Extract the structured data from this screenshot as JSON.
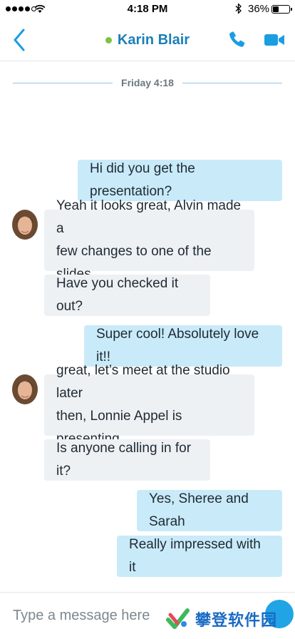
{
  "status_bar": {
    "signal_dots_filled": 4,
    "signal_dots_total": 5,
    "time": "4:18 PM",
    "battery_percent": "36%",
    "battery_level": 0.36,
    "icons": [
      "wifi-icon",
      "bluetooth-icon",
      "battery-icon"
    ]
  },
  "header": {
    "contact_name": "Karin Blair",
    "presence": "online",
    "presence_color": "#7cc243",
    "accent_color": "#1b7fb8",
    "icons": [
      "back-chevron-icon",
      "phone-icon",
      "video-camera-icon"
    ]
  },
  "conversation": {
    "date_label": "Friday 4:18",
    "messages": [
      {
        "direction": "outgoing",
        "text": "Hi did you get the presentation?"
      },
      {
        "direction": "incoming",
        "text": "Yeah it looks great, Alvin made a few changes to one of the slides",
        "line1": "Yeah it looks great, Alvin made a",
        "line2": "few changes to one of the slides",
        "avatar": true
      },
      {
        "direction": "incoming",
        "text": "Have you checked it out?"
      },
      {
        "direction": "outgoing",
        "text": "Super cool! Absolutely love it!!"
      },
      {
        "direction": "incoming",
        "text": "great, let's meet at the studio later then, Lonnie Appel is presenting",
        "line1": "great, let’s meet at the studio later",
        "line2": "then, Lonnie Appel is presenting",
        "avatar": true
      },
      {
        "direction": "incoming",
        "text": "Is anyone calling in for it?"
      },
      {
        "direction": "outgoing",
        "text": "Yes, Sheree and Sarah"
      },
      {
        "direction": "outgoing",
        "text": "Really impressed with it"
      }
    ],
    "outgoing_bubble_color": "#c9eaf9",
    "incoming_bubble_color": "#eef1f4"
  },
  "composer": {
    "placeholder": "Type a message here",
    "value": ""
  },
  "watermark": {
    "text": "攀登软件园"
  }
}
